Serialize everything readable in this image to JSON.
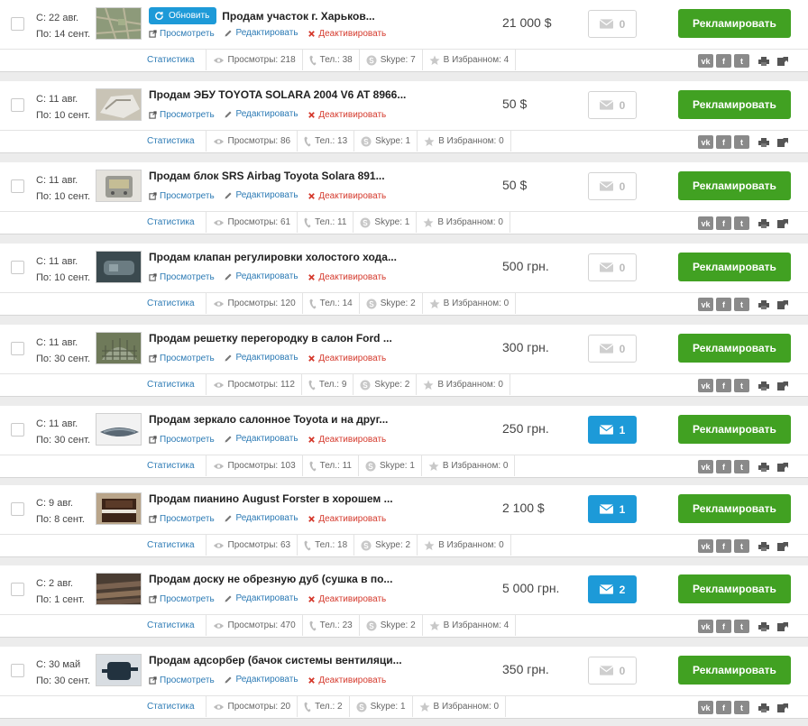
{
  "ui": {
    "update_label": "Обновить",
    "view_label": "Просмотреть",
    "edit_label": "Редактировать",
    "deactivate_label": "Деактивировать",
    "promote_label": "Рекламировать",
    "stats_label": "Статистика",
    "views_label": "Просмотры:",
    "tel_label": "Тел.:",
    "skype_label": "Skype:",
    "fav_label": "В Избранном:",
    "vk_label": "vk",
    "fb_label": "f",
    "tw_label": "t"
  },
  "colors": {
    "accent_blue": "#1d9ad8",
    "promo_green": "#41a122",
    "deactivate_red": "#d53a2d",
    "link_blue": "#2d7bb5"
  },
  "listings": [
    {
      "from": "С: 22 авг.",
      "to": "По: 14 сент.",
      "title": "Продам участок г. Харьков...",
      "has_update": true,
      "price": "21 000 $",
      "messages": "0",
      "views": "218",
      "tel": "38",
      "skype": "7",
      "fav": "4",
      "thumb": "map"
    },
    {
      "from": "С: 11 авг.",
      "to": "По: 10 сент.",
      "title": "Продам ЭБУ TOYOTA SOLARA 2004 V6 AT 8966...",
      "has_update": false,
      "price": "50 $",
      "messages": "0",
      "views": "86",
      "tel": "13",
      "skype": "1",
      "fav": "0",
      "thumb": "ecu"
    },
    {
      "from": "С: 11 авг.",
      "to": "По: 10 сент.",
      "title": "Продам блок SRS Airbag Toyota Solara 891...",
      "has_update": false,
      "price": "50 $",
      "messages": "0",
      "views": "61",
      "tel": "11",
      "skype": "1",
      "fav": "0",
      "thumb": "srs"
    },
    {
      "from": "С: 11 авг.",
      "to": "По: 10 сент.",
      "title": "Продам клапан регулировки холостого хода...",
      "has_update": false,
      "price": "500 грн.",
      "messages": "0",
      "views": "120",
      "tel": "14",
      "skype": "2",
      "fav": "0",
      "thumb": "valve"
    },
    {
      "from": "С: 11 авг.",
      "to": "По: 30 сент.",
      "title": "Продам решетку перегородку в салон Ford ...",
      "has_update": false,
      "price": "300 грн.",
      "messages": "0",
      "views": "112",
      "tel": "9",
      "skype": "2",
      "fav": "0",
      "thumb": "grid"
    },
    {
      "from": "С: 11 авг.",
      "to": "По: 30 сент.",
      "title": "Продам зеркало салонное Toyota и на друг...",
      "has_update": false,
      "price": "250 грн.",
      "messages": "1",
      "views": "103",
      "tel": "11",
      "skype": "1",
      "fav": "0",
      "thumb": "mirror"
    },
    {
      "from": "С: 9 авг.",
      "to": "По: 8 сент.",
      "title": "Продам пианино August Forster в хорошем ...",
      "has_update": false,
      "price": "2 100 $",
      "messages": "1",
      "views": "63",
      "tel": "18",
      "skype": "2",
      "fav": "0",
      "thumb": "piano"
    },
    {
      "from": "С: 2 авг.",
      "to": "По: 1 сент.",
      "title": "Продам доску не обрезную дуб (сушка в по...",
      "has_update": false,
      "price": "5 000 грн.",
      "messages": "2",
      "views": "470",
      "tel": "23",
      "skype": "2",
      "fav": "4",
      "thumb": "boards"
    },
    {
      "from": "С: 30 май",
      "to": "По: 30 сент.",
      "title": "Продам адсорбер (бачок системы вентиляци...",
      "has_update": false,
      "price": "350 грн.",
      "messages": "0",
      "views": "20",
      "tel": "2",
      "skype": "1",
      "fav": "0",
      "thumb": "adsorber"
    }
  ]
}
